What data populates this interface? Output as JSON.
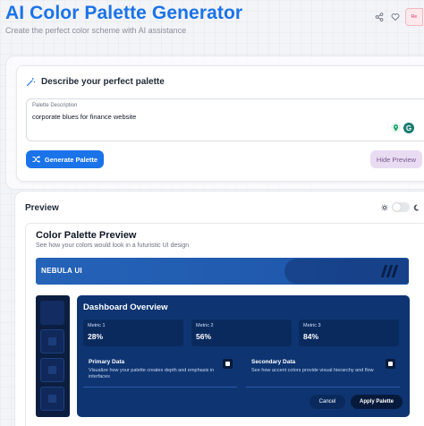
{
  "header": {
    "title": "AI Color Palette Generator",
    "subtitle": "Create the perfect color scheme with AI assistance",
    "reset_label": "Re"
  },
  "describe": {
    "heading": "Describe your perfect palette",
    "field_label": "Palette Description",
    "field_value": "corporate blues for finance website",
    "generate_label": "Generate Palette",
    "hide_preview_label": "Hide Preview"
  },
  "preview": {
    "heading": "Preview",
    "theme_toggle_on": false,
    "card_title": "Color Palette Preview",
    "card_subtitle": "See how your colors would look in a futuristic UI design",
    "brand": "NEBULA UI",
    "dashboard": {
      "title": "Dashboard Overview",
      "metrics": [
        {
          "label": "Metric 1",
          "value": "28%"
        },
        {
          "label": "Metric 2",
          "value": "56%"
        },
        {
          "label": "Metric 3",
          "value": "84%"
        }
      ],
      "panels": [
        {
          "title": "Primary Data",
          "text": "Visualize how your palette creates depth and emphasis in interfaces"
        },
        {
          "title": "Secondary Data",
          "text": "See how accent colors provide visual hierarchy and flow"
        }
      ],
      "cancel_label": "Cancel",
      "apply_label": "Apply Palette"
    }
  },
  "colors": {
    "accent": "#1a73e8",
    "hide_button_bg": "#e9dcf2",
    "nebula_bar": "#2563b8",
    "dashboard_bg": "#0e3572",
    "sidebar_bg": "#0b1e3f"
  },
  "icons": {
    "share": "share-icon",
    "favorite": "heart-icon",
    "magic": "magic-wand-icon",
    "shuffle": "shuffle-icon",
    "sun": "sun-icon",
    "moon": "moon-icon"
  }
}
